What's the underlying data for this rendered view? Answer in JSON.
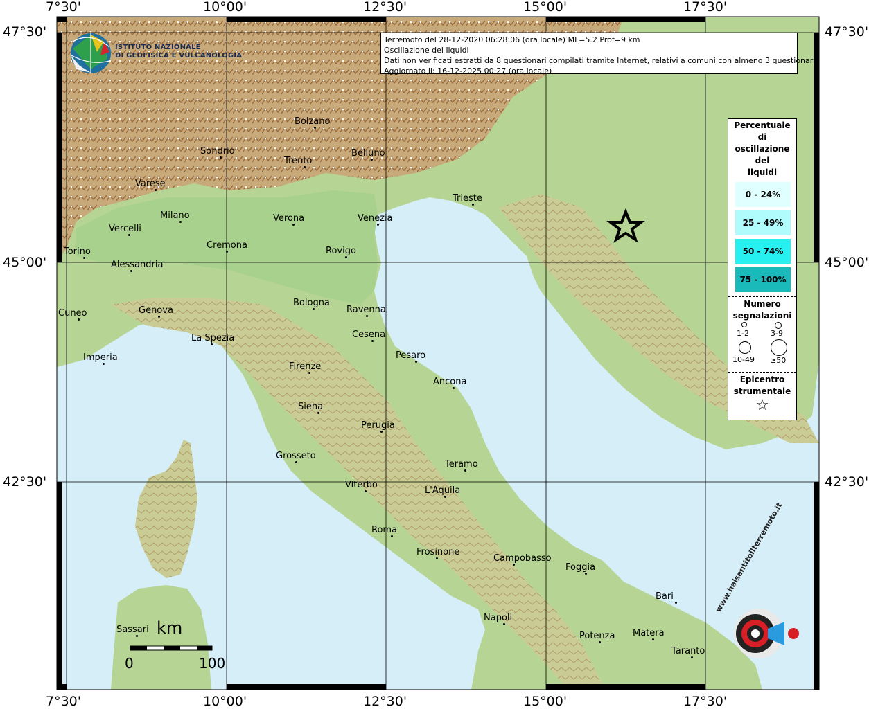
{
  "grid": {
    "lon_labels": [
      "7°30'",
      "10°00'",
      "12°30'",
      "15°00'",
      "17°30'"
    ],
    "lat_labels": [
      "47°30'",
      "45°00'",
      "42°30'"
    ]
  },
  "info": {
    "line1": "Terremoto del 28-12-2020 06:28:06 (ora locale) ML=5.2 Prof=9 km",
    "line2": "Oscillazione dei liquidi",
    "line3": "Dati non verificati estratti da 8 questionari compilati tramite Internet, relativi a comuni con almeno 3 questionari.",
    "line4": "Aggiornato il: 16-12-2025 00:27 (ora locale)"
  },
  "logo": {
    "line1": "ISTITUTO NAZIONALE",
    "line2": "DI GEOFISICA E VULCANOLOGIA"
  },
  "legend": {
    "title1": "Percentuale",
    "title2": "di",
    "title3": "oscillazione",
    "title4": "del",
    "title5": "liquidi",
    "ranges": [
      {
        "label": "0 - 24%",
        "color": "#e0ffff"
      },
      {
        "label": "25 - 49%",
        "color": "#b0fbfb"
      },
      {
        "label": "50 - 74%",
        "color": "#27f0f0"
      },
      {
        "label": "75 - 100%",
        "color": "#1ab9ba"
      }
    ],
    "count_title1": "Numero",
    "count_title2": "segnalazioni",
    "counts": [
      "1-2",
      "3-9",
      "10-49",
      "≥50"
    ],
    "epi_title1": "Epicentro",
    "epi_title2": "strumentale"
  },
  "scale": {
    "unit": "km",
    "start": "0",
    "end": "100"
  },
  "watermark": {
    "text": "www.haisentitoilterremoto.it"
  },
  "colors": {
    "sea": "#d6eef8",
    "lowland": "#a9d18e",
    "hill": "#d9c79a",
    "mountain": "#b8865a",
    "snow": "#ffffff"
  },
  "cities": [
    {
      "name": "Bolzano"
    },
    {
      "name": "Sondrio"
    },
    {
      "name": "Trento"
    },
    {
      "name": "Belluno"
    },
    {
      "name": "Varese"
    },
    {
      "name": "Milano"
    },
    {
      "name": "Vercelli"
    },
    {
      "name": "Verona"
    },
    {
      "name": "Venezia"
    },
    {
      "name": "Trieste"
    },
    {
      "name": "Torino"
    },
    {
      "name": "Cremona"
    },
    {
      "name": "Rovigo"
    },
    {
      "name": "Alessandria"
    },
    {
      "name": "Cuneo"
    },
    {
      "name": "Genova"
    },
    {
      "name": "Bologna"
    },
    {
      "name": "Ravenna"
    },
    {
      "name": "La Spezia"
    },
    {
      "name": "Cesena"
    },
    {
      "name": "Imperia"
    },
    {
      "name": "Pesaro"
    },
    {
      "name": "Firenze"
    },
    {
      "name": "Ancona"
    },
    {
      "name": "Siena"
    },
    {
      "name": "Perugia"
    },
    {
      "name": "Grosseto"
    },
    {
      "name": "Teramo"
    },
    {
      "name": "Viterbo"
    },
    {
      "name": "L'Aquila"
    },
    {
      "name": "Roma"
    },
    {
      "name": "Frosinone"
    },
    {
      "name": "Campobasso"
    },
    {
      "name": "Foggia"
    },
    {
      "name": "Bari"
    },
    {
      "name": "Napoli"
    },
    {
      "name": "Sassari"
    },
    {
      "name": "Potenza"
    },
    {
      "name": "Matera"
    },
    {
      "name": "Taranto"
    }
  ]
}
